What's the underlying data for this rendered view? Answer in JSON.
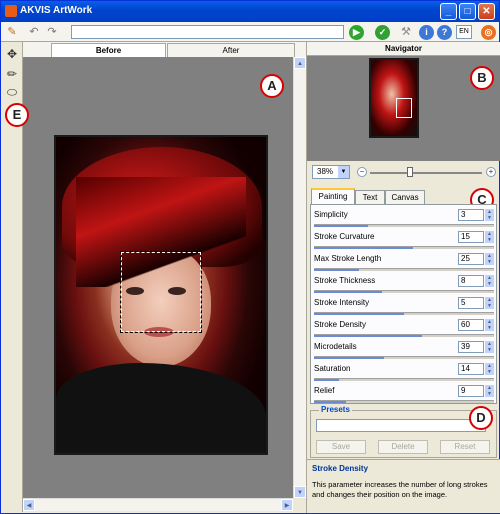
{
  "window": {
    "title": "AKVIS ArtWork",
    "lang": "EN"
  },
  "tabs": {
    "before": "Before",
    "after": "After"
  },
  "navigator": {
    "title": "Navigator",
    "zoom": "38%"
  },
  "param_tabs": [
    "Painting",
    "Text",
    "Canvas"
  ],
  "params": [
    {
      "label": "Simplicity",
      "value": "3",
      "fill": 0.3
    },
    {
      "label": "Stroke Curvature",
      "value": "15",
      "fill": 0.55
    },
    {
      "label": "Max Stroke Length",
      "value": "25",
      "fill": 0.25
    },
    {
      "label": "Stroke Thickness",
      "value": "8",
      "fill": 0.38
    },
    {
      "label": "Stroke Intensity",
      "value": "5",
      "fill": 0.5
    },
    {
      "label": "Stroke Density",
      "value": "60",
      "fill": 0.6
    },
    {
      "label": "Microdetails",
      "value": "39",
      "fill": 0.39
    },
    {
      "label": "Saturation",
      "value": "14",
      "fill": 0.14
    },
    {
      "label": "Relief",
      "value": "9",
      "fill": 0.18
    }
  ],
  "presets": {
    "title": "Presets",
    "save": "Save",
    "delete": "Delete",
    "reset": "Reset"
  },
  "hint": {
    "title": "Stroke Density",
    "text": "This parameter increases the number of long strokes and changes their position on the image."
  },
  "markers": {
    "a": "A",
    "b": "B",
    "c": "C",
    "d": "D",
    "e": "E"
  }
}
